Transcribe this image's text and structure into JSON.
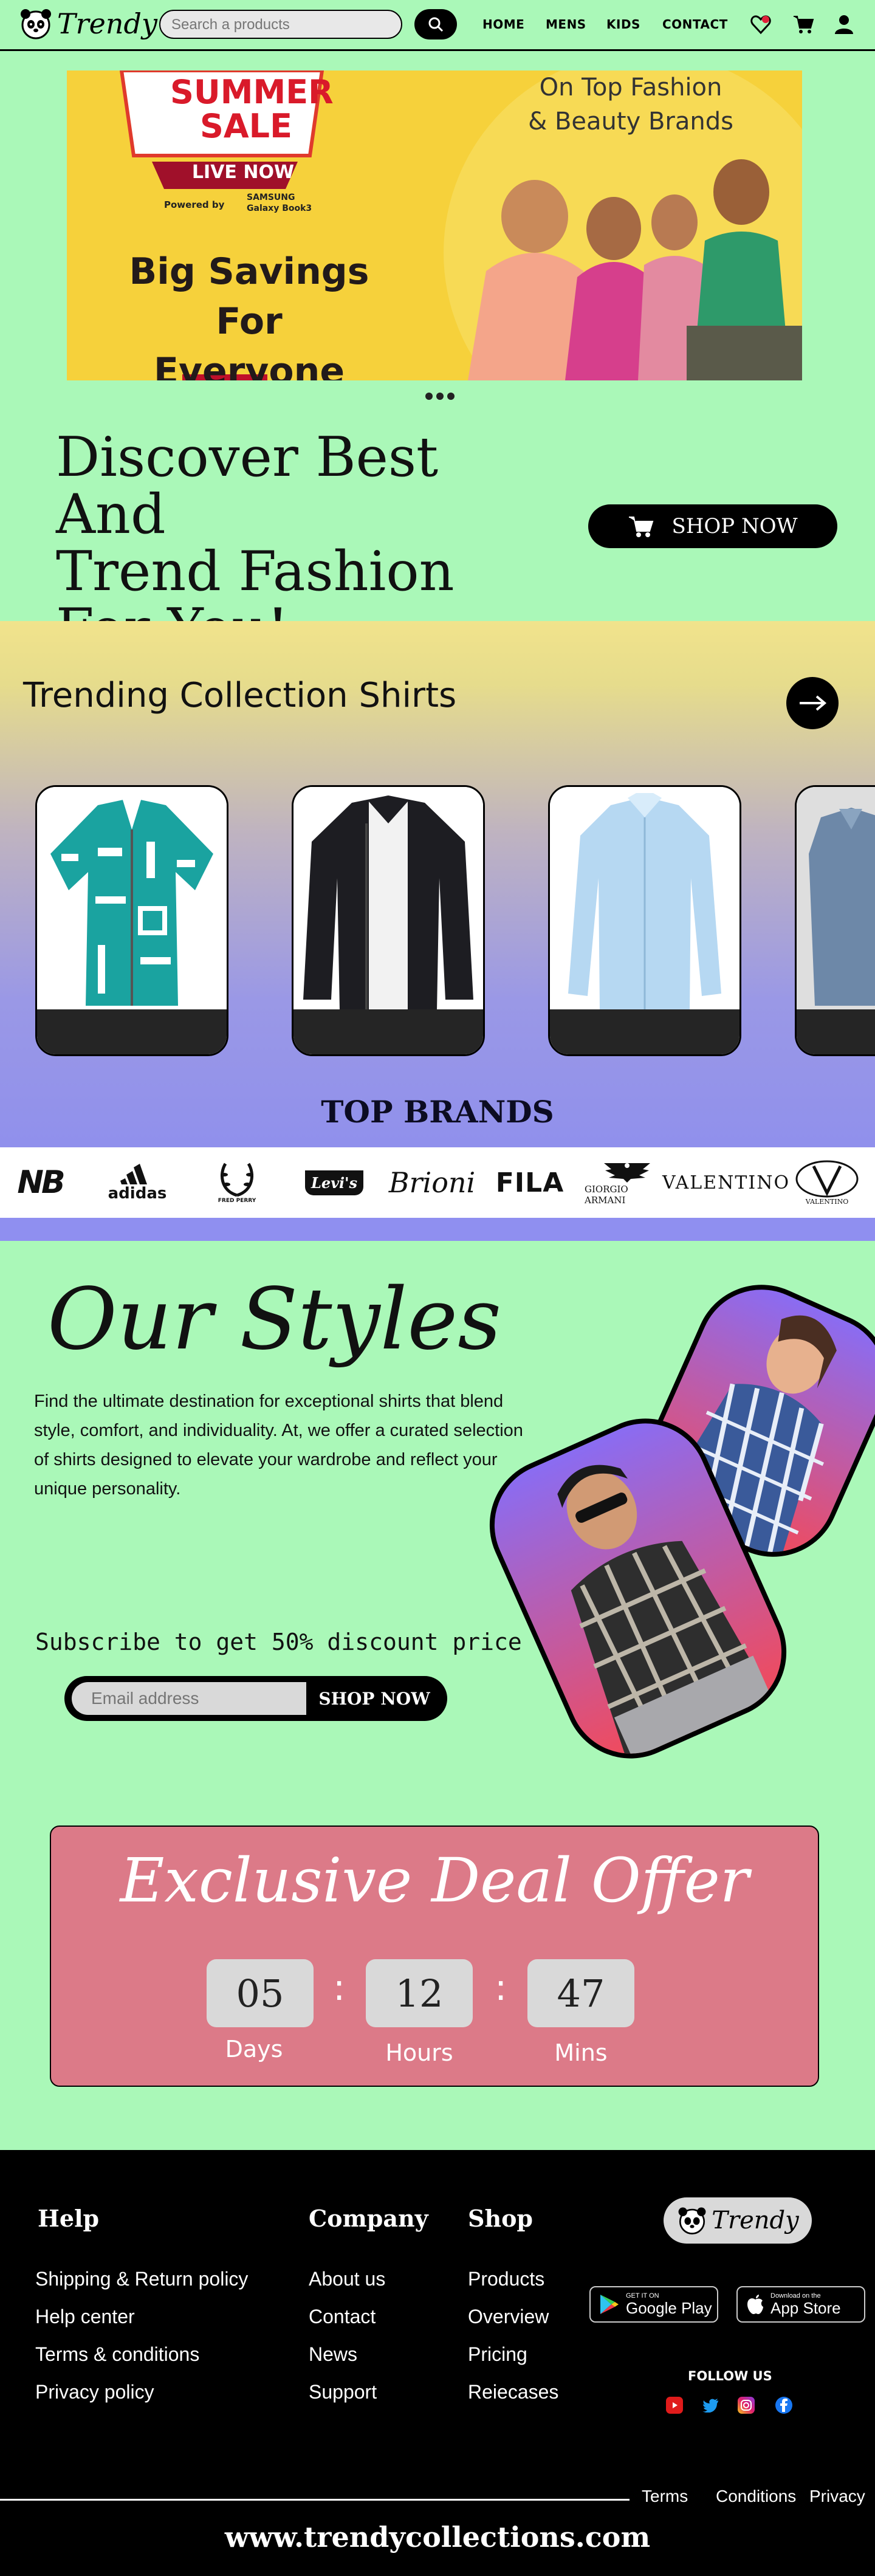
{
  "header": {
    "logo_text": "Trendy",
    "search_placeholder": "Search a products",
    "nav": [
      "HOME",
      "MENS",
      "KIDS",
      "CONTACT"
    ]
  },
  "banner": {
    "sale_title_1": "SUMMER",
    "sale_title_2": "SALE",
    "live_now": "LIVE NOW",
    "powered_by": "Powered by",
    "powered_brand_1": "SAMSUNG",
    "powered_brand_2": "Galaxy Book3",
    "tagline_1": "On Top Fashion",
    "tagline_2": "& Beauty Brands",
    "headline_1": "Big Savings",
    "headline_2": "For Everyone"
  },
  "hero": {
    "title_line1": "Discover Best And",
    "title_line2": "Trend Fashion",
    "title_line3": "For You!",
    "cta": "SHOP NOW"
  },
  "trending": {
    "title": "Trending Collection Shirts",
    "items": [
      "teal-print-shirt",
      "black-bomber-jacket",
      "light-blue-shirt",
      "grey-blue-shirt"
    ]
  },
  "brands": {
    "title": "TOP BRANDS",
    "items": [
      "NB",
      "adidas",
      "FRED PERRY",
      "Levi's",
      "Brioni",
      "FILA",
      "GIORGIO ARMANI",
      "VALENTINO",
      "VALENTINO"
    ]
  },
  "styles": {
    "title": "Our Styles",
    "description": "Find the ultimate destination for exceptional shirts that blend style, comfort, and individuality. At, we offer a curated selection of shirts designed to elevate your wardrobe and reflect your unique personality.",
    "subscribe_text": "Subscribe to get 50% discount price",
    "email_placeholder": "Email address",
    "subscribe_button": "SHOP NOW"
  },
  "deal": {
    "title": "Exclusive Deal Offer",
    "days": "05",
    "hours": "12",
    "mins": "47",
    "days_label": "Days",
    "hours_label": "Hours",
    "mins_label": "Mins"
  },
  "footer": {
    "help": {
      "heading": "Help",
      "links": [
        "Shipping & Return policy",
        "Help center",
        "Terms & conditions",
        "Privacy policy"
      ]
    },
    "company": {
      "heading": "Company",
      "links": [
        "About us",
        "Contact",
        "News",
        "Support"
      ]
    },
    "shop": {
      "heading": "Shop",
      "links": [
        "Products",
        "Overview",
        "Pricing",
        "Reiecases"
      ]
    },
    "logo_text": "Trendy",
    "google_small": "GET IT ON",
    "google_big": "Google Play",
    "apple_small": "Download on the",
    "apple_big": "App Store",
    "follow": "FOLLOW US",
    "bottom_links": [
      "Terms",
      "Conditions",
      "Privacy"
    ],
    "site_url": "www.trendycollections.com"
  },
  "colors": {
    "page_bg": "#aaf8b8",
    "deal_bg": "#dc7a88",
    "footer_bg": "#000000",
    "brands_bar": "#8f8ff0"
  }
}
